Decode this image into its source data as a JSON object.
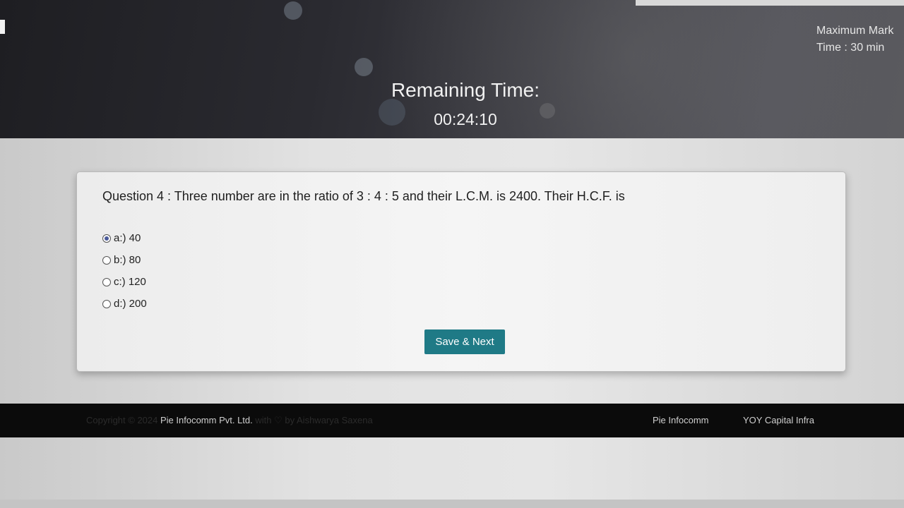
{
  "header": {
    "remaining_label": "Remaining Time:",
    "remaining_value": "00:24:10",
    "maximum_marks": "Maximum Mark",
    "time_limit": "Time : 30 min"
  },
  "question": {
    "text": "Question 4 : Three number are in the ratio of 3 : 4 : 5 and their L.C.M. is 2400. Their H.C.F. is",
    "options": [
      {
        "label": "a:) 40",
        "selected": true
      },
      {
        "label": "b:) 80",
        "selected": false
      },
      {
        "label": "c:) 120",
        "selected": false
      },
      {
        "label": "d:) 200",
        "selected": false
      }
    ],
    "save_label": "Save & Next"
  },
  "footer": {
    "copyright_prefix": "Copyright © 2024",
    "company": "Pie Infocomm Pvt. Ltd.",
    "made_with": "with ♡ by Aishwarya Saxena",
    "links": [
      "Pie Infocomm",
      "YOY Capital Infra"
    ]
  },
  "colors": {
    "accent_button": "#1f7a86",
    "banner_dark": "#1e1e22",
    "footer_bg": "#0b0b0b"
  }
}
